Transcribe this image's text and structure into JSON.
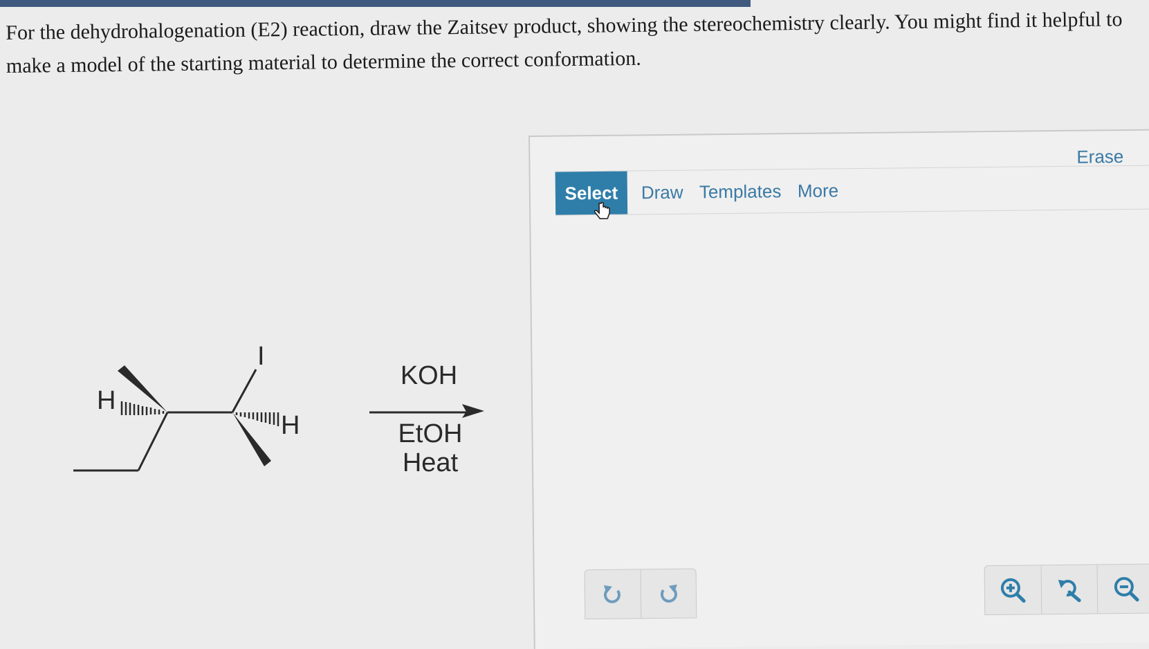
{
  "question": {
    "text": "For the dehydrohalogenation (E2) reaction, draw the Zaitsev product, showing the stereochemistry clearly. You might find it helpful to make a model of the starting material to determine the correct conformation."
  },
  "molecule": {
    "atoms": {
      "h_left": "H",
      "iodine": "I",
      "h_right": "H"
    }
  },
  "reaction": {
    "reagent_top": "KOH",
    "reagent_bottom_1": "EtOH",
    "reagent_bottom_2": "Heat"
  },
  "editor": {
    "tools": {
      "select": "Select",
      "draw": "Draw",
      "templates": "Templates",
      "more": "More"
    },
    "erase": "Erase",
    "accent": "#2f7ea9",
    "link_color": "#3a7aa5",
    "icons": {
      "undo": "undo-icon",
      "redo": "redo-icon",
      "zoom_in": "zoom-in-icon",
      "zoom_reset": "zoom-reset-icon",
      "zoom_out": "zoom-out-icon",
      "cursor": "hand-cursor-icon"
    }
  }
}
